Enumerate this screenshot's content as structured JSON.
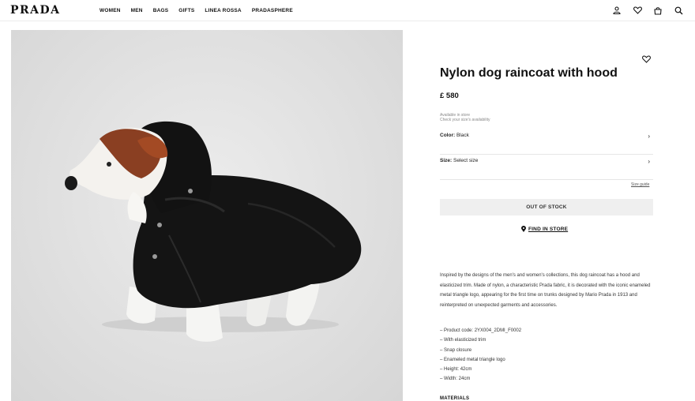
{
  "brand": {
    "logo": "PRADA"
  },
  "nav": {
    "items": [
      {
        "label": "WOMEN"
      },
      {
        "label": "MEN"
      },
      {
        "label": "BAGS"
      },
      {
        "label": "GIFTS"
      },
      {
        "label": "LINEA ROSSA"
      },
      {
        "label": "PRADASPHERE"
      }
    ]
  },
  "header_icons": [
    "user-icon",
    "heart-icon",
    "shopping-bag-icon",
    "search-icon"
  ],
  "product": {
    "title": "Nylon dog raincoat with hood",
    "price": "£ 580",
    "availability": "Available in store",
    "availability_sub": "Check your size's availability",
    "color_label": "Color:",
    "color_value": "Black",
    "size_label": "Size:",
    "size_value": "Select size",
    "size_guide": "Size guide",
    "out_of_stock": "OUT OF STOCK",
    "find_in_store": "FIND IN STORE",
    "description": "Inspired by the designs of the men's and women's collections, this dog raincoat has a hood and elasticized trim. Made of nylon, a characteristic Prada fabric, it is decorated with the iconic enameled metal triangle logo, appearing for the first time on trunks designed by Mario Prada in 1913 and reinterpreted on unexpected garments and accessories.",
    "specs": [
      "Product code: 2YX004_2DMI_F0002",
      "With elasticized trim",
      "Snap closure",
      "Enameled metal triangle logo",
      "Height: 42cm",
      "Width: 24cm"
    ],
    "materials_heading": "MATERIALS"
  },
  "colors": {
    "text": "#111111",
    "button_bg": "#efefef",
    "image_bg": "#e2e2e2",
    "coat": "#141414"
  }
}
